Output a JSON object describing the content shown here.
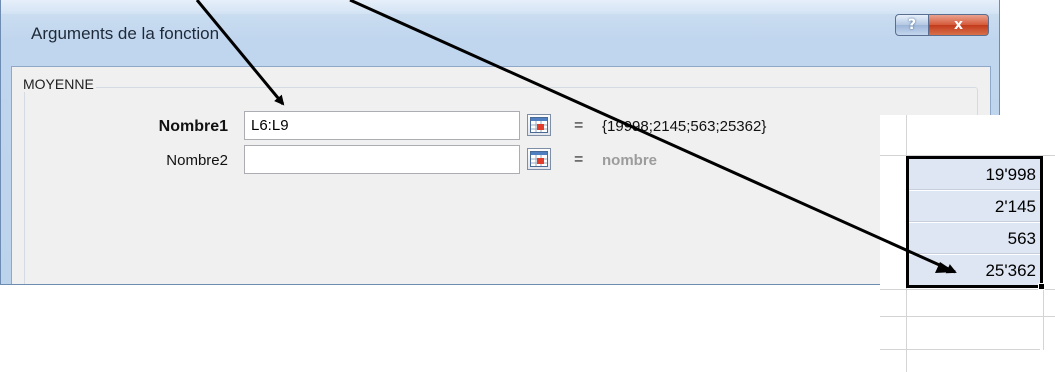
{
  "dialog": {
    "title": "Arguments de la fonction",
    "help_glyph": "?",
    "close_glyph": "x",
    "function_name": "MOYENNE",
    "args": [
      {
        "label": "Nombre1",
        "value": "L6:L9",
        "result": "{19998;2145;563;25362}"
      },
      {
        "label": "Nombre2",
        "value": "",
        "result": "nombre"
      }
    ],
    "equals": "="
  },
  "sheet": {
    "cells": [
      "19'998",
      "2'145",
      "563",
      "25'362"
    ]
  },
  "colors": {
    "title_bar": "#c0d6ee",
    "close_button": "#c23a1c",
    "selection_fill": "#dfe6f3",
    "placeholder_text": "#9c9c9c"
  }
}
